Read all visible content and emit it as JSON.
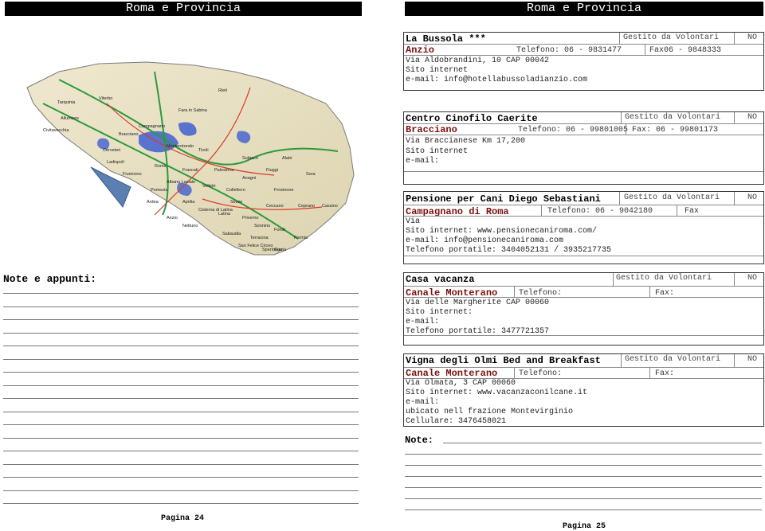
{
  "header": {
    "left_title": "Roma e Provincia",
    "right_title": "Roma e Provincia"
  },
  "map": {
    "towns": [
      "Tarquinia",
      "Viterbo",
      "Civitavecchia",
      "Allumiere",
      "Cerveteri",
      "Fiumicino",
      "Roma",
      "Frascati",
      "Anzio",
      "Aprilia",
      "Latina",
      "Nettuno",
      "Velletri",
      "Albano Laziale",
      "Pomezia",
      "Ardea",
      "Campagnano",
      "Bracciano",
      "Tivoli",
      "Subiaco",
      "Fiuggi",
      "Frosinone",
      "Anagni",
      "Cassino",
      "Formia",
      "Gaeta",
      "Terracina",
      "Sezze",
      "Cisterna di Latina",
      "Sabaudia",
      "Rieti",
      "Fara in Sabina",
      "Monterotondo",
      "Palestrina",
      "Colleferro",
      "Ceccano",
      "Sora",
      "Alatri",
      "Sperlonga",
      "Ceprano",
      "Fondi",
      "Priverno",
      "San Felice Circeo",
      "Sonnino",
      "Ladispoli"
    ]
  },
  "notes": {
    "title": "Note e appunti:",
    "note_label": "Note:"
  },
  "cards": [
    {
      "name": "La Bussola ***",
      "gestito": "Gestito da Volontari",
      "no": "NO",
      "location": "Anzio",
      "telefono": "Telefono: 06 - 9831477",
      "fax": "Fax06 - 9848333",
      "lines": [
        "Via Aldobrandini, 10 CAP 00042",
        "Sito internet",
        "e-mail: info@hotellabussoladianzio.com"
      ]
    },
    {
      "name": "Centro Cinofilo Caerite",
      "gestito": "Gestito da Volontari",
      "no": "NO",
      "location": "Bracciano",
      "telefono": "Telefono: 06 - 99801005",
      "fax": "Fax: 06 - 99801173",
      "lines": [
        "Via Braccianese Km 17,200",
        "Sito internet",
        "e-mail:"
      ]
    },
    {
      "name": "Pensione per Cani Diego Sebastiani",
      "gestito": "Gestito da Volontari",
      "no": "NO",
      "location": "Campagnano di Roma",
      "telefono": "Telefono: 06 - 9042180",
      "fax": "Fax",
      "lines": [
        "Via",
        "Sito internet: www.pensionecaniroma.com/",
        "e-mail: info@pensionecaniroma.com",
        "Telefono portatile: 3404052131 / 3935217735"
      ]
    },
    {
      "name": "Casa vacanza",
      "gestito": "Gestito da Volontari",
      "no": "NO",
      "location": "Canale Monterano",
      "telefono": "Telefono:",
      "fax": "Fax:",
      "lines": [
        "Via delle Margherite CAP 00060",
        "Sito internet:",
        "e-mail:",
        "Telefono portatile: 3477721357"
      ]
    },
    {
      "name": "Vigna degli Olmi Bed and Breakfast",
      "gestito": "Gestito da Volontari",
      "no": "NO",
      "location": "Canale Monterano",
      "telefono": "Telefono:",
      "fax": "Fax:",
      "lines": [
        "Via Olmata, 3 CAP 00060",
        "Sito internet: www.vacanzaconilcane.it",
        "e-mail:",
        "ubicato nell frazione Montevirginio",
        "Cellulare: 3476458021"
      ]
    }
  ],
  "footer": {
    "left_page": "Pagina 24",
    "right_page": "Pagina 25"
  },
  "colors": {
    "header_bg": "#000000",
    "location_text": "#7a1010",
    "sea": "#ffffff",
    "land": "#e8e2c8"
  }
}
